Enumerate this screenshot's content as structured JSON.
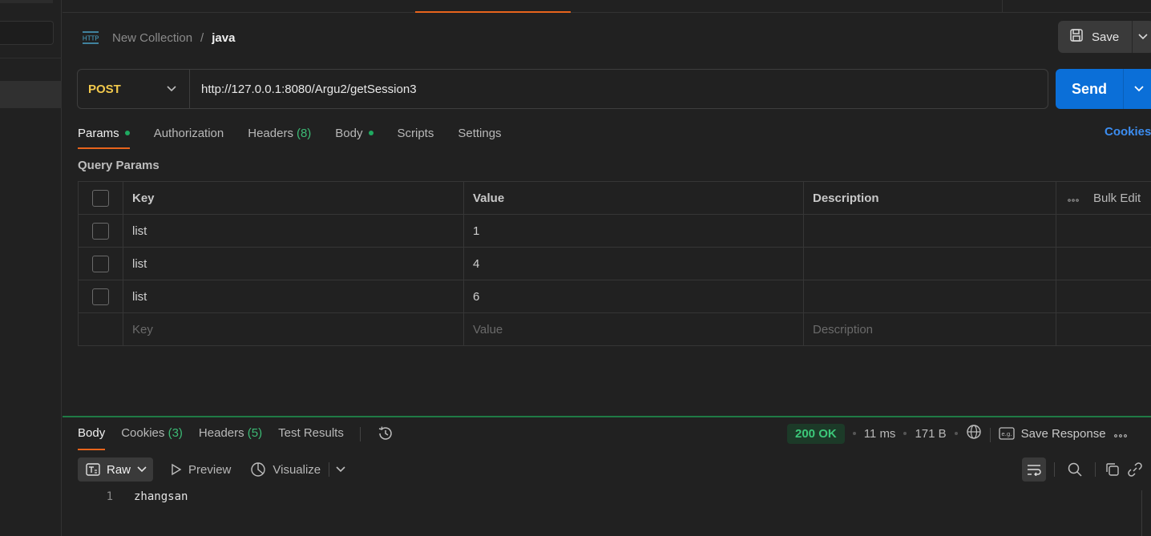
{
  "breadcrumb": {
    "icon": "http-icon",
    "parent": "New Collection",
    "separator": "/",
    "current": "java"
  },
  "toolbar": {
    "save_label": "Save"
  },
  "request": {
    "method": "POST",
    "url": "http://127.0.0.1:8080/Argu2/getSession3",
    "send_label": "Send"
  },
  "tabs": {
    "params": "Params",
    "authorization": "Authorization",
    "headers": "Headers",
    "headers_count": "(8)",
    "body": "Body",
    "scripts": "Scripts",
    "settings": "Settings",
    "cookies": "Cookies"
  },
  "query_params": {
    "title": "Query Params",
    "columns": {
      "key": "Key",
      "value": "Value",
      "description": "Description",
      "bulk_edit": "Bulk Edit"
    },
    "rows": [
      {
        "key": "list",
        "value": "1"
      },
      {
        "key": "list",
        "value": "4"
      },
      {
        "key": "list",
        "value": "6"
      }
    ],
    "placeholders": {
      "key": "Key",
      "value": "Value",
      "description": "Description"
    }
  },
  "response": {
    "tabs": {
      "body": "Body",
      "cookies": "Cookies",
      "cookies_count": "(3)",
      "headers": "Headers",
      "headers_count": "(5)",
      "test_results": "Test Results"
    },
    "status": "200 OK",
    "time": "11 ms",
    "size": "171 B",
    "save_response": "Save Response",
    "format": "Raw",
    "preview": "Preview",
    "visualize": "Visualize",
    "lines": [
      {
        "no": "1",
        "text": "zhangsan"
      }
    ]
  },
  "colors": {
    "accent": "#e8641c",
    "send_blue": "#0b6fd8",
    "method_yellow": "#f2c94c",
    "status_green": "#3cc779",
    "link_blue": "#3c8df0"
  }
}
